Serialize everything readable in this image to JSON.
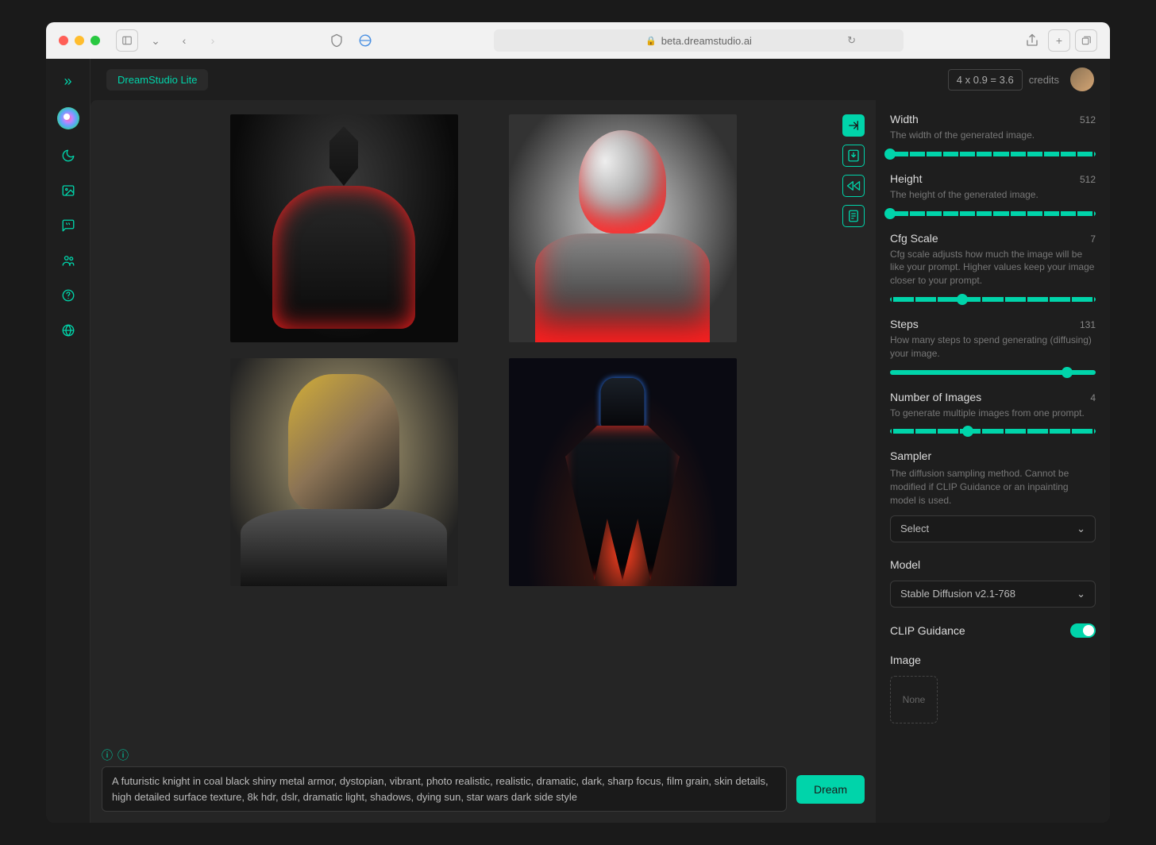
{
  "browser": {
    "url": "beta.dreamstudio.ai"
  },
  "header": {
    "badge": "DreamStudio Lite",
    "credits_calc": "4 x 0.9 = 3.6",
    "credits_label": "credits"
  },
  "actions": {
    "export": "export",
    "download": "download",
    "rewind": "rewind",
    "document": "document"
  },
  "prompt": {
    "text": "A futuristic knight in coal black shiny metal armor, dystopian,  vibrant, photo realistic, realistic, dramatic, dark, sharp focus, film grain, skin details, high detailed surface texture, 8k hdr, dslr, dramatic light, shadows, dying sun, star wars dark side style",
    "dream_label": "Dream"
  },
  "settings": {
    "width": {
      "label": "Width",
      "value": "512",
      "desc": "The width of the generated image.",
      "pct": 0
    },
    "height": {
      "label": "Height",
      "value": "512",
      "desc": "The height of the generated image.",
      "pct": 0
    },
    "cfg": {
      "label": "Cfg Scale",
      "value": "7",
      "desc": "Cfg scale adjusts how much the image will be like your prompt. Higher values keep your image closer to your prompt.",
      "pct": 35
    },
    "steps": {
      "label": "Steps",
      "value": "131",
      "desc": "How many steps to spend generating (diffusing) your image.",
      "pct": 86
    },
    "num_images": {
      "label": "Number of Images",
      "value": "4",
      "desc": "To generate multiple images from one prompt.",
      "pct": 38
    },
    "sampler": {
      "label": "Sampler",
      "desc": "The diffusion sampling method. Cannot be modified if CLIP Guidance or an inpainting model is used.",
      "selected": "Select"
    },
    "model": {
      "label": "Model",
      "selected": "Stable Diffusion v2.1-768"
    },
    "clip": {
      "label": "CLIP Guidance",
      "on": true
    },
    "image": {
      "label": "Image",
      "drop": "None"
    }
  }
}
